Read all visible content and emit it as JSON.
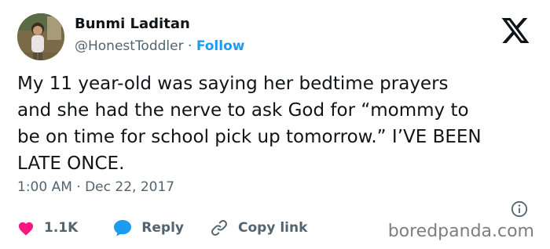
{
  "author": {
    "display_name": "Bunmi Laditan",
    "handle": "@HonestToddler",
    "separator": "·",
    "follow_label": "Follow",
    "avatar_icon": "profile-photo"
  },
  "platform": {
    "logo_icon": "x-logo"
  },
  "tweet": {
    "lines": [
      "My 11 year-old was saying her bedtime prayers",
      "and she had the nerve to ask God for “mommy to",
      "be on time for school pick up tomorrow.” I’VE BEEN",
      "LATE ONCE."
    ],
    "timestamp": "1:00 AM · Dec 22, 2017"
  },
  "actions": {
    "like_count": "1.1K",
    "reply_label": "Reply",
    "copy_link_label": "Copy link"
  },
  "watermark": "boredpanda.com",
  "colors": {
    "accent": "#1d9bf0",
    "like": "#f91880",
    "text": "#0f1419",
    "muted": "#536471"
  }
}
